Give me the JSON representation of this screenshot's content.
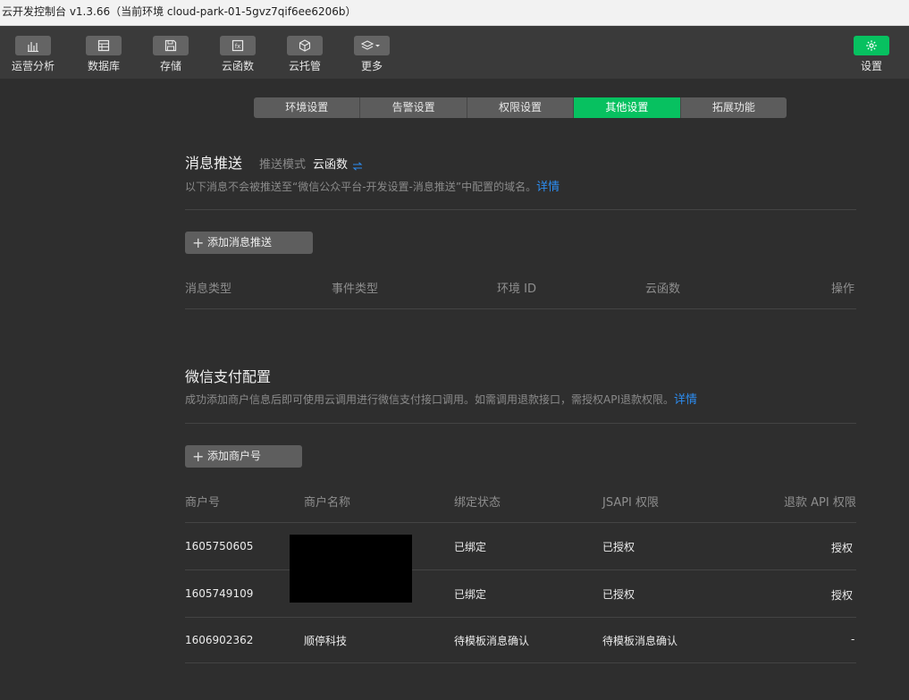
{
  "window": {
    "title": "云开发控制台 v1.3.66（当前环境 cloud-park-01-5gvz7qif6ee6206b）"
  },
  "toolbar": {
    "items": [
      {
        "label": "运营分析",
        "icon": "bar-chart-icon"
      },
      {
        "label": "数据库",
        "icon": "database-icon"
      },
      {
        "label": "存储",
        "icon": "storage-icon"
      },
      {
        "label": "云函数",
        "icon": "function-icon"
      },
      {
        "label": "云托管",
        "icon": "cube-icon"
      },
      {
        "label": "更多",
        "icon": "layers-icon"
      }
    ],
    "settings": {
      "label": "设置",
      "icon": "gear-icon"
    }
  },
  "tabs": [
    {
      "label": "环境设置",
      "active": false
    },
    {
      "label": "告警设置",
      "active": false
    },
    {
      "label": "权限设置",
      "active": false
    },
    {
      "label": "其他设置",
      "active": true
    },
    {
      "label": "拓展功能",
      "active": false
    }
  ],
  "push": {
    "title": "消息推送",
    "mode_label": "推送模式",
    "mode_value": "云函数",
    "switch_icon": "swap-icon",
    "desc": "以下消息不会被推送至“微信公众平台-开发设置-消息推送”中配置的域名。",
    "detail_link": "详情",
    "add_button": "添加消息推送",
    "columns": [
      "消息类型",
      "事件类型",
      "环境 ID",
      "云函数",
      "操作"
    ]
  },
  "pay": {
    "title": "微信支付配置",
    "desc": "成功添加商户信息后即可使用云调用进行微信支付接口调用。如需调用退款接口，需授权API退款权限。",
    "detail_link": "详情",
    "add_button": "添加商户号",
    "columns": [
      "商户号",
      "商户名称",
      "绑定状态",
      "JSAPI 权限",
      "退款 API 权限"
    ],
    "rows": [
      {
        "merchant_id": "1605750605",
        "name": "",
        "bind_status": "已绑定",
        "jsapi": "已授权",
        "refund": "授权"
      },
      {
        "merchant_id": "1605749109",
        "name": "",
        "bind_status": "已绑定",
        "jsapi": "已授权",
        "refund": "授权"
      },
      {
        "merchant_id": "1606902362",
        "name": "顺停科技",
        "bind_status": "待模板消息确认",
        "jsapi": "待模板消息确认",
        "refund": "-"
      }
    ]
  },
  "colors": {
    "accent": "#07c160",
    "link": "#2c8cf0",
    "background": "#2e2e2e",
    "toolbar": "#3a3a3a"
  }
}
